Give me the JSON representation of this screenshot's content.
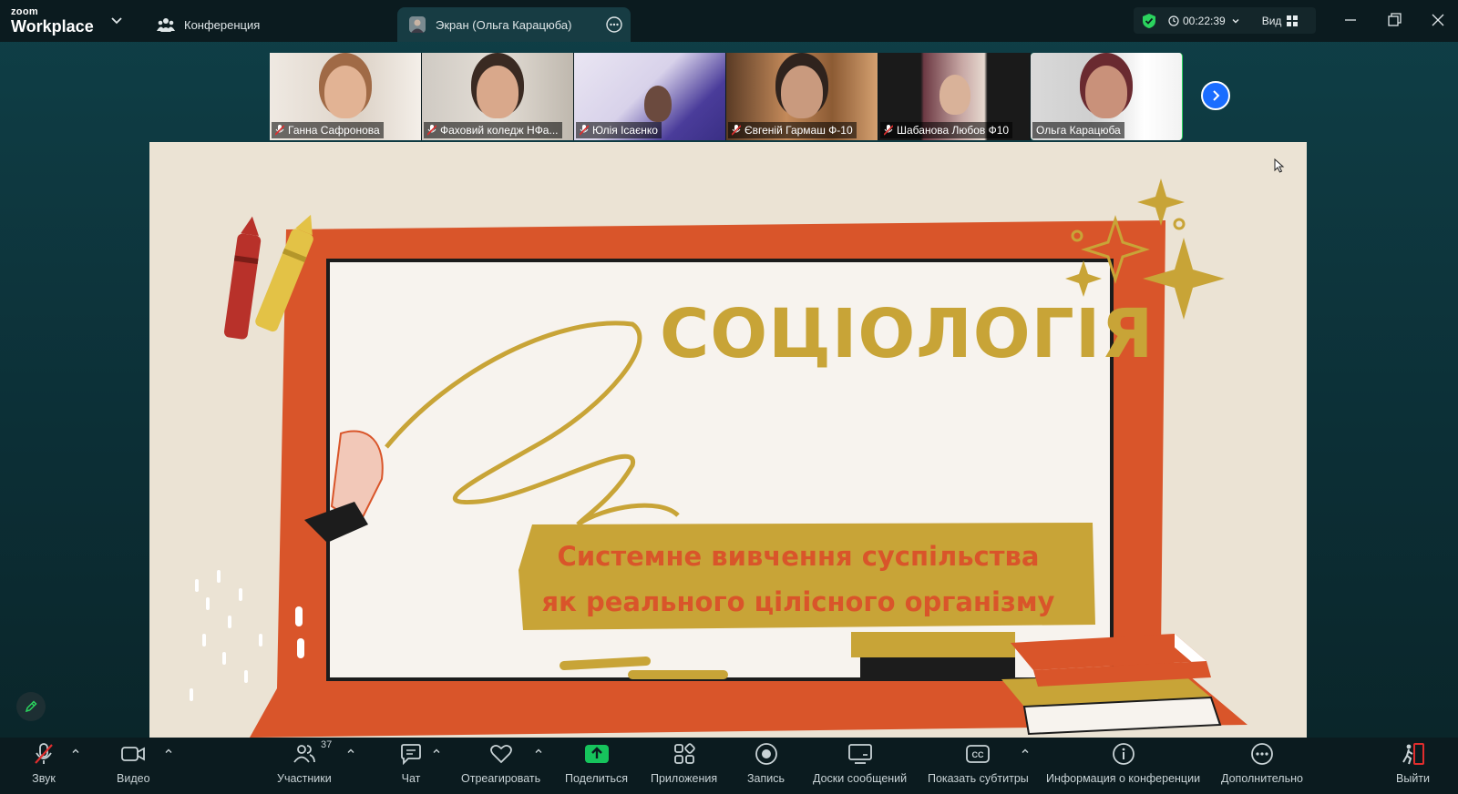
{
  "app": {
    "logo_top": "zoom",
    "logo_bottom": "Workplace"
  },
  "tabs": {
    "conference": "Конференция",
    "screen": "Экран (Ольга Карацюба)"
  },
  "status": {
    "timer": "00:22:39",
    "view_label": "Вид"
  },
  "participants_strip": [
    {
      "name": "Ганна Сафронова",
      "muted": true
    },
    {
      "name": "Фаховий коледж НФа...",
      "muted": true
    },
    {
      "name": "Юлія Ісаєнко",
      "muted": true
    },
    {
      "name": "Євгеній Гармаш Ф-10",
      "muted": true
    },
    {
      "name": "Шабанова Любов Ф10",
      "muted": true
    },
    {
      "name": "Ольга Карацюба",
      "muted": false,
      "active": true
    }
  ],
  "slide": {
    "title": "СОЦІОЛОГІЯ",
    "subtitle_line1": "Системне вивчення суспільства",
    "subtitle_line2": "як реального цілісного організму"
  },
  "toolbar": {
    "audio": "Звук",
    "video": "Видео",
    "participants": "Участники",
    "participants_count": "37",
    "chat": "Чат",
    "react": "Отреагировать",
    "share": "Поделиться",
    "apps": "Приложения",
    "record": "Запись",
    "whiteboards": "Доски сообщений",
    "captions": "Показать субтитры",
    "info": "Информация о конференции",
    "more": "Дополнительно",
    "leave": "Выйти"
  },
  "colors": {
    "accent_green": "#2bd35e",
    "share_green": "#16c45c",
    "leave_red": "#e02d2d",
    "slide_orange": "#d9552a",
    "slide_gold": "#c8a437"
  }
}
